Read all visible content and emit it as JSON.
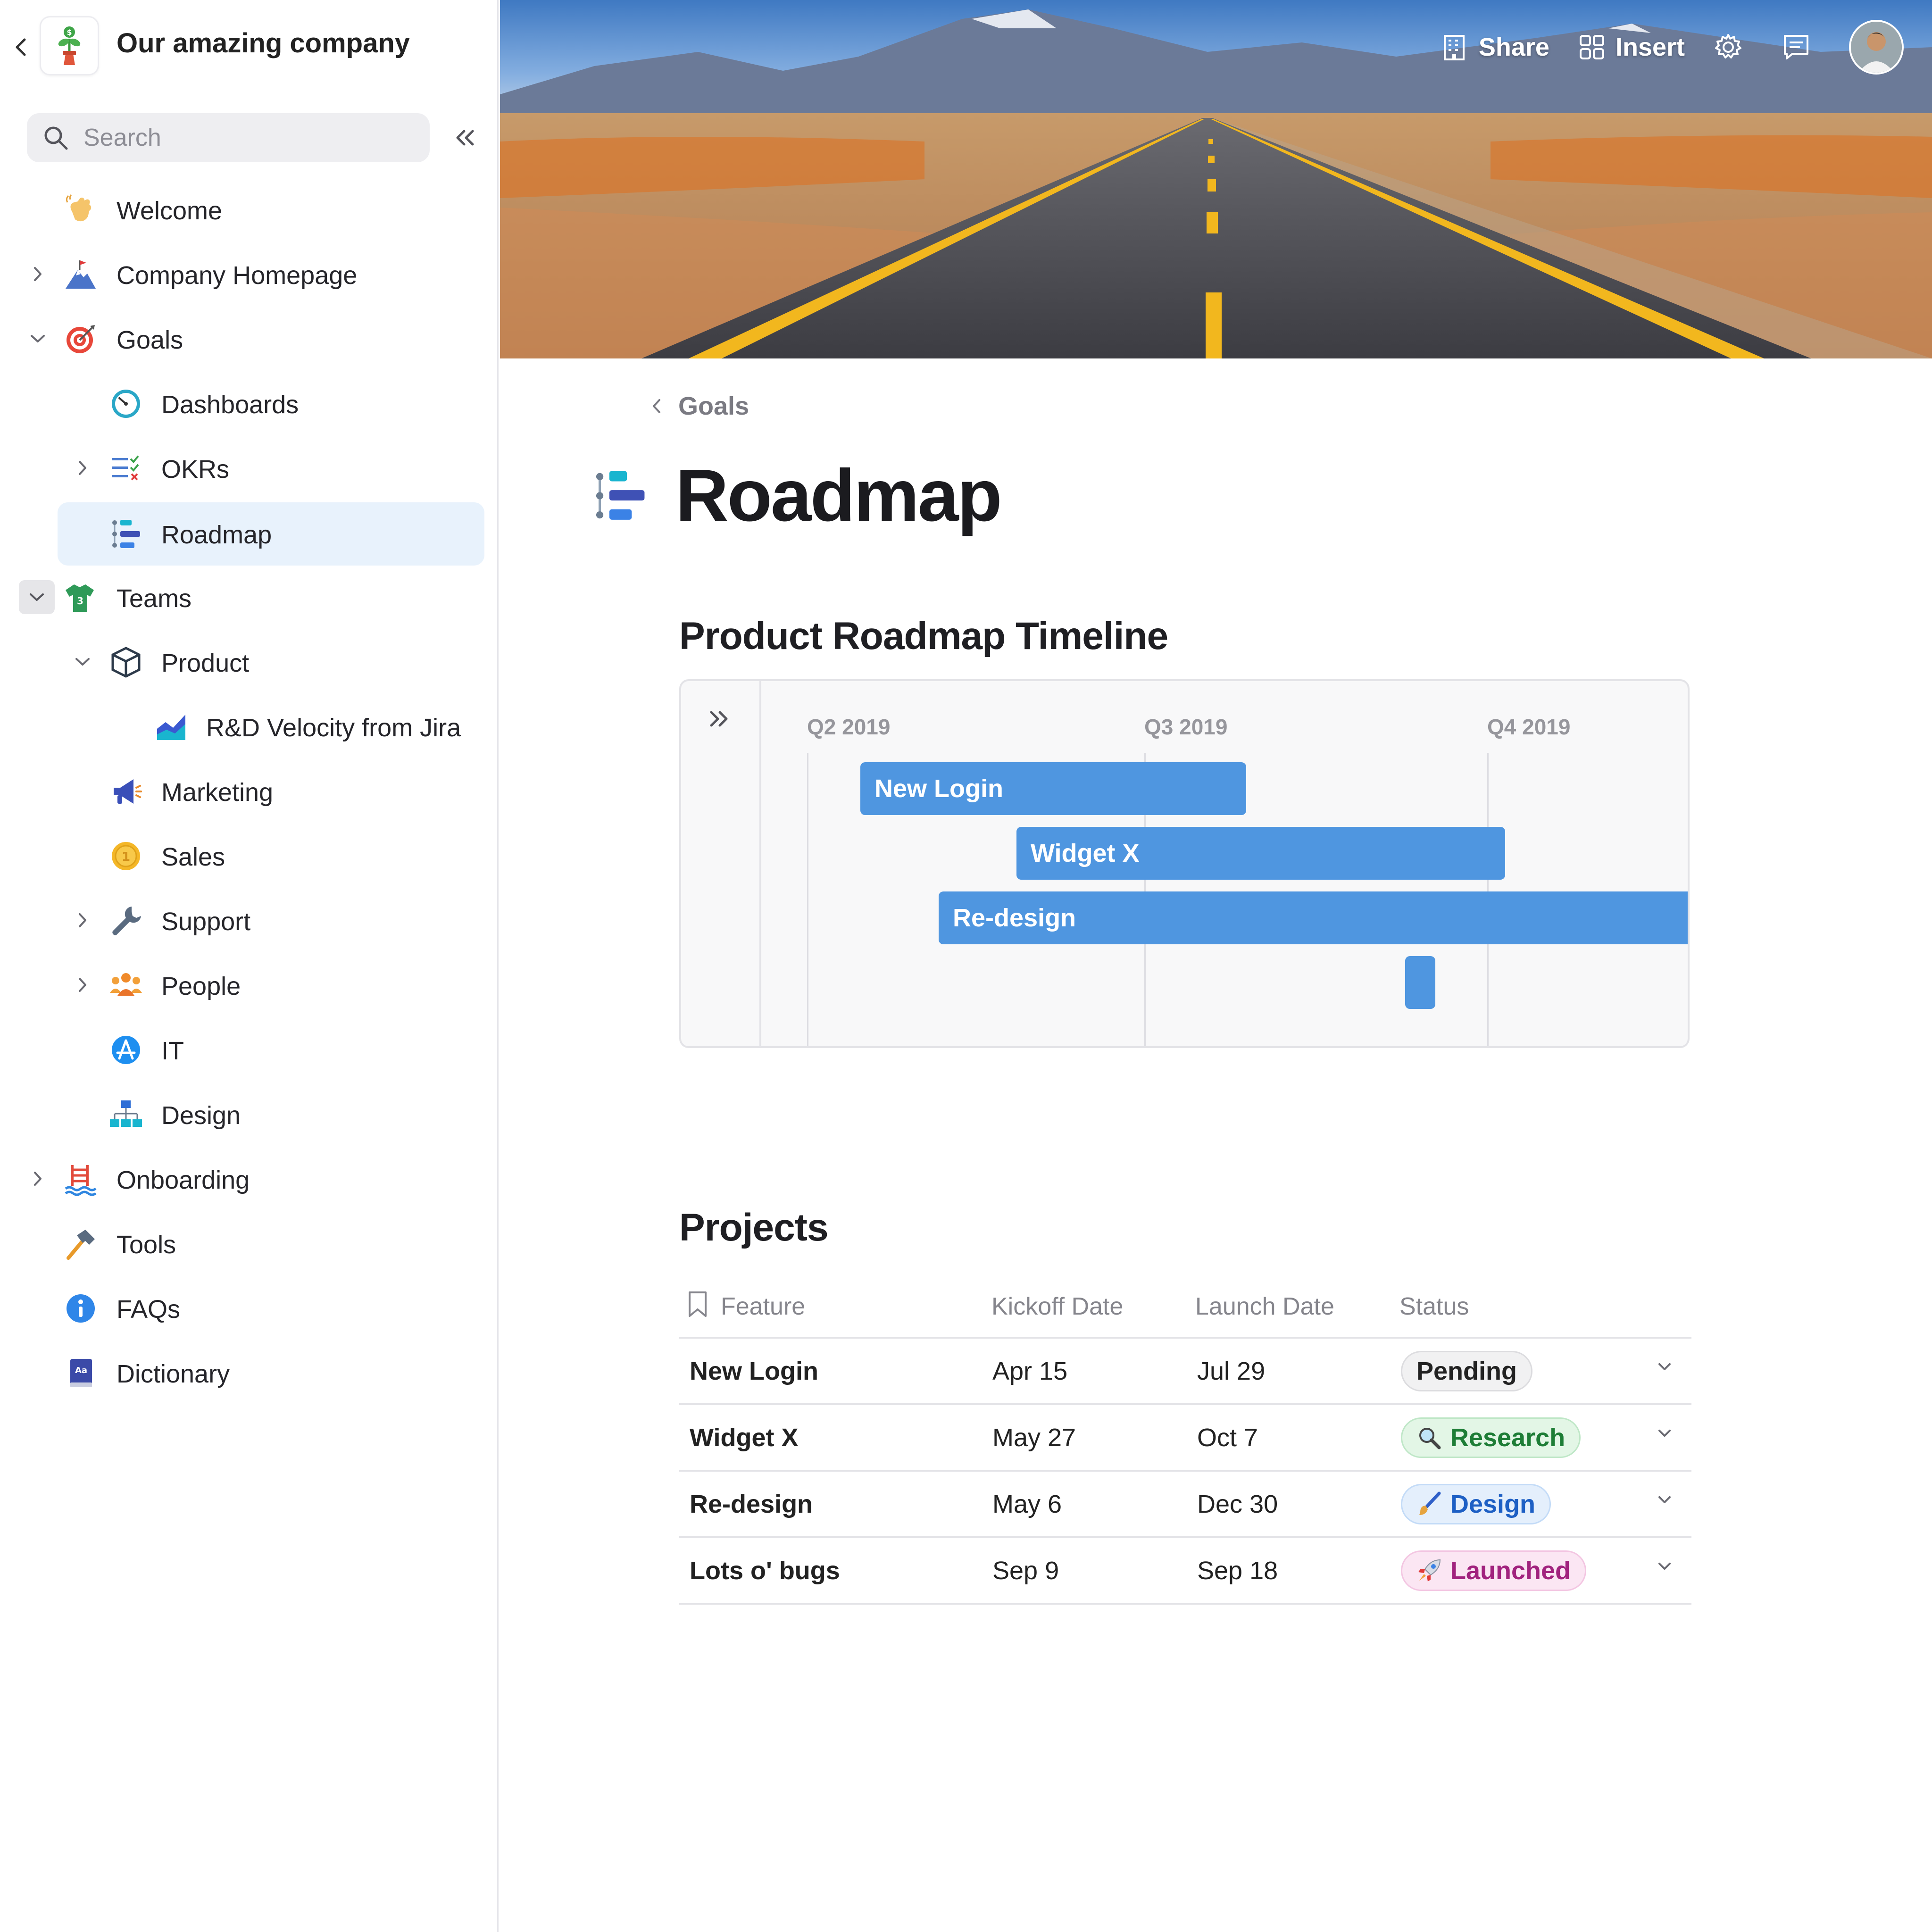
{
  "sidebar": {
    "company_name": "Our amazing company",
    "search_placeholder": "Search",
    "items": [
      {
        "label": "Welcome"
      },
      {
        "label": "Company Homepage"
      },
      {
        "label": "Goals"
      },
      {
        "label": "Dashboards"
      },
      {
        "label": "OKRs"
      },
      {
        "label": "Roadmap"
      },
      {
        "label": "Teams"
      },
      {
        "label": "Product"
      },
      {
        "label": "R&D Velocity from Jira"
      },
      {
        "label": "Marketing"
      },
      {
        "label": "Sales"
      },
      {
        "label": "Support"
      },
      {
        "label": "People"
      },
      {
        "label": "IT"
      },
      {
        "label": "Design"
      },
      {
        "label": "Onboarding"
      },
      {
        "label": "Tools"
      },
      {
        "label": "FAQs"
      },
      {
        "label": "Dictionary"
      }
    ]
  },
  "topbar": {
    "share_label": "Share",
    "insert_label": "Insert"
  },
  "page": {
    "breadcrumb": "Goals",
    "title": "Roadmap"
  },
  "timeline": {
    "title": "Product Roadmap Timeline",
    "quarters": [
      "Q2 2019",
      "Q3 2019",
      "Q4 2019"
    ],
    "bars": [
      {
        "label": "New Login",
        "start": "Apr 15",
        "end": "Jul 29"
      },
      {
        "label": "Widget X",
        "start": "May 27",
        "end": "Oct 7"
      },
      {
        "label": "Re-design",
        "start": "May 6",
        "end": "Dec 30"
      },
      {
        "label": "",
        "start": "Sep 9",
        "end": "Sep 18"
      }
    ],
    "bar_color": "#4f96e0"
  },
  "projects": {
    "title": "Projects",
    "columns": [
      "Feature",
      "Kickoff Date",
      "Launch Date",
      "Status"
    ],
    "rows": [
      {
        "feature": "New Login",
        "kickoff": "Apr 15",
        "launch": "Jul 29",
        "status": "Pending"
      },
      {
        "feature": "Widget X",
        "kickoff": "May 27",
        "launch": "Oct 7",
        "status": "Research"
      },
      {
        "feature": "Re-design",
        "kickoff": "May 6",
        "launch": "Dec 30",
        "status": "Design"
      },
      {
        "feature": "Lots o' bugs",
        "kickoff": "Sep 9",
        "launch": "Sep 18",
        "status": "Launched"
      }
    ],
    "status_colors": {
      "Pending": "#222222",
      "Research": "#1e7d36",
      "Design": "#1d5fc4",
      "Launched": "#a1237e"
    }
  }
}
